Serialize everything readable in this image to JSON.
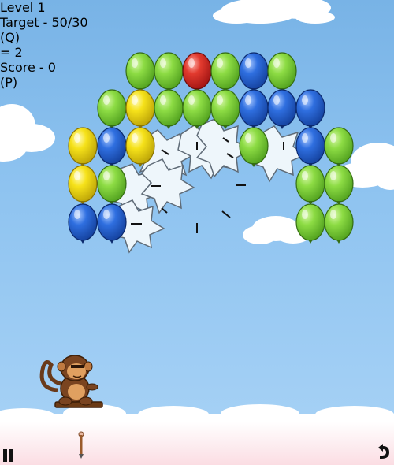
{
  "hud": {
    "level": "Level 1",
    "target": "Target - 50/30",
    "pause_label": "(Q)",
    "darts": "= 2",
    "score": "Score - 0",
    "undo_label": "(P)"
  },
  "colors": {
    "green": "#7fd33a",
    "red": "#e02a2a",
    "blue": "#1f5fd8",
    "yellow": "#f2dd1a"
  },
  "balloons": [
    [
      "green",
      "green",
      "red",
      "green",
      "blue",
      "green"
    ],
    [
      "green",
      "yellow",
      "green",
      "green",
      "green",
      "blue",
      "blue",
      "blue"
    ],
    [
      "yellow",
      "blue",
      "yellow",
      "green",
      "blue",
      "green"
    ],
    [
      "yellow",
      "green",
      "green",
      "green"
    ],
    [
      "blue",
      "blue",
      "green",
      "green"
    ]
  ]
}
